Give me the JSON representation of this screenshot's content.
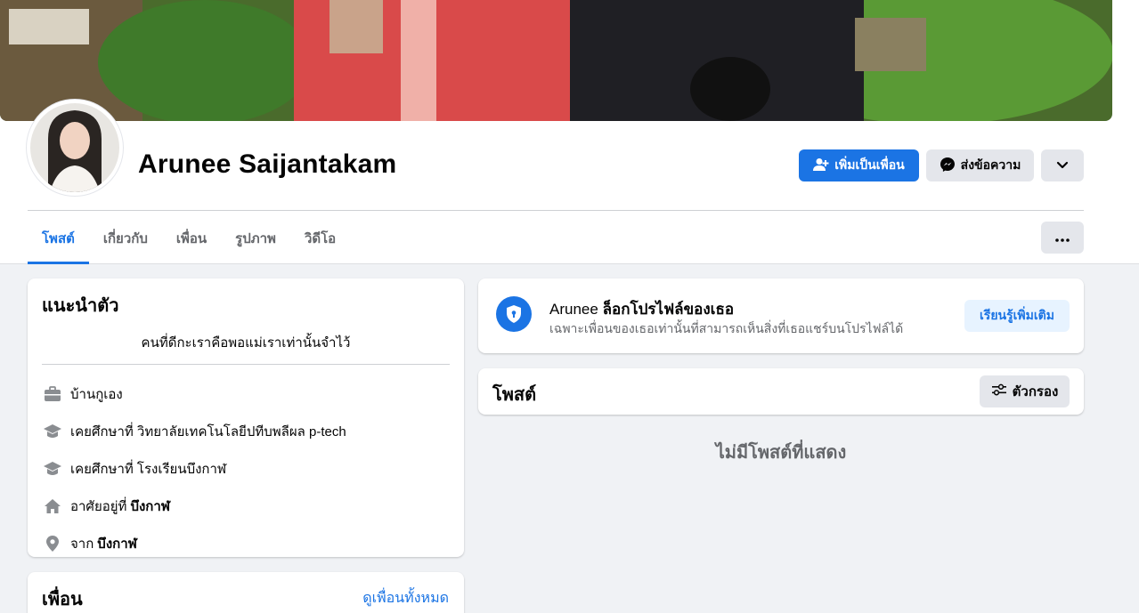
{
  "profile": {
    "name": "Arunee Saijantakam"
  },
  "actions": {
    "add_friend": "เพิ่มเป็นเพื่อน",
    "message": "ส่งข้อความ"
  },
  "tabs": [
    {
      "label": "โพสต์",
      "active": true
    },
    {
      "label": "เกี่ยวกับ",
      "active": false
    },
    {
      "label": "เพื่อน",
      "active": false
    },
    {
      "label": "รูปภาพ",
      "active": false
    },
    {
      "label": "วิดีโอ",
      "active": false
    }
  ],
  "intro": {
    "title": "แนะนำตัว",
    "bio": "คนที่ดีกะเราคือพอแม่เราเท่านั้นจำไว้",
    "items": [
      {
        "icon": "briefcase-icon",
        "text": "บ้านกูเอง",
        "bold": ""
      },
      {
        "icon": "graduation-cap-icon",
        "text": "เคยศึกษาที่ วิทยาลัยเทคโนโลยีปทีบพลีผล p-tech",
        "bold": ""
      },
      {
        "icon": "graduation-cap-icon",
        "text": "เคยศึกษาที่ โรงเรียนบึงกาฬ",
        "bold": ""
      },
      {
        "icon": "home-icon",
        "text": "อาศัยอยู่ที่",
        "bold": "บึงกาฬ"
      },
      {
        "icon": "location-pin-icon",
        "text": "จาก",
        "bold": "บึงกาฬ"
      }
    ]
  },
  "friends": {
    "title": "เพื่อน",
    "see_all": "ดูเพื่อนทั้งหมด"
  },
  "locked": {
    "name": "Arunee",
    "title_rest": "ล็อกโปรไฟล์ของเธอ",
    "subtitle": "เฉพาะเพื่อนของเธอเท่านั้นที่สามารถเห็นสิ่งที่เธอแชร์บนโปรไฟล์ได้",
    "learn_more": "เรียนรู้เพิ่มเติม"
  },
  "posts": {
    "title": "โพสต์",
    "filter": "ตัวกรอง",
    "empty": "ไม่มีโพสต์ที่แสดง"
  },
  "colors": {
    "accent": "#1b74e4",
    "background": "#f0f2f5",
    "secondary_text": "#65676b"
  }
}
